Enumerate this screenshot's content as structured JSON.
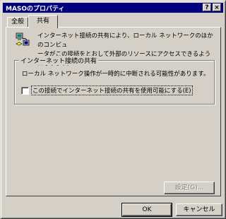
{
  "window": {
    "title": "MASOのプロパティ",
    "help_button": "?",
    "close_button": "×"
  },
  "tabs": [
    {
      "label": "全般",
      "selected": false
    },
    {
      "label": "共有",
      "selected": true
    }
  ],
  "sharing": {
    "description": "インターネット接続の共有により、ローカル ネットワークのほかのコンピュ\nータがこの接続をとおして外部のリソースにアクセスできるようになります。",
    "group_label": "インターネット接続の共有",
    "warning": "ローカル ネットワーク操作が一時的に中断される可能性があります。",
    "checkbox_label": "この接続でインターネット接続の共有を使用可能にする(E)",
    "checkbox_checked": false,
    "settings_button": "設定(G)..."
  },
  "footer": {
    "ok_label": "OK",
    "cancel_label": "キャンセル"
  },
  "colors": {
    "titlebar": "#000080",
    "face": "#d4d0c8"
  }
}
